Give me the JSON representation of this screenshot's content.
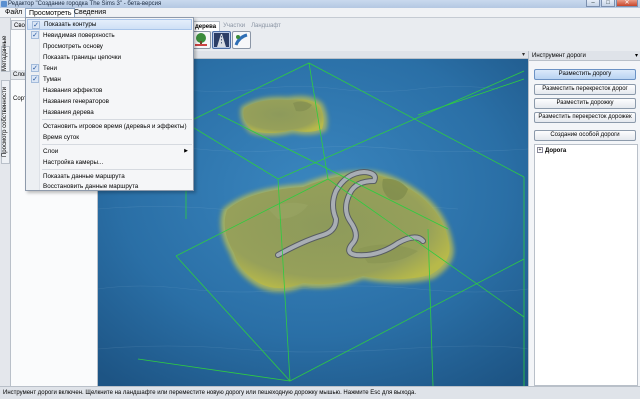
{
  "window": {
    "title": "Редактор \"Создание городка The Sims 3\" - бета-версия",
    "min": "–",
    "max": "□",
    "close": "✕"
  },
  "menubar": [
    {
      "label": "Файл"
    },
    {
      "label": "Просмотреть"
    },
    {
      "label": "Сведения"
    }
  ],
  "left_rail_tabs": [
    "Метаданные",
    "Просмотр собственности"
  ],
  "left_panel": {
    "tab_label": "Своб",
    "strip_label": "Слои",
    "row_label": "Сорт"
  },
  "top_tabs": [
    {
      "label": "дерева"
    },
    {
      "label": "Участки"
    },
    {
      "label": "Ландшафт"
    }
  ],
  "viewport": {
    "pin": "▾"
  },
  "view_menu": {
    "items": [
      {
        "label": "Показать контуры",
        "checked": true
      },
      {
        "label": "Невидимая поверхность",
        "checked": true
      },
      {
        "label": "Просмотреть основу",
        "checked": false
      },
      {
        "label": "Показать границы цепочки",
        "checked": false
      },
      {
        "label": "Тени",
        "checked": true
      },
      {
        "label": "Туман",
        "checked": true
      },
      {
        "label": "Названия эффектов",
        "checked": false
      },
      {
        "label": "Названия генераторов",
        "checked": false
      },
      {
        "label": "Названия дерева",
        "checked": false
      },
      {
        "label": "Остановить игровое время (деревья и эффекты)",
        "checked": false
      },
      {
        "label": "Время суток",
        "checked": false
      },
      {
        "label": "Слои",
        "checked": false,
        "submenu_arrow": "▶"
      },
      {
        "label": "Настройка камеры...",
        "checked": false
      },
      {
        "label": "Показать данные маршрута",
        "checked": false
      },
      {
        "label": "Восстановить данные маршрута",
        "checked": false
      }
    ],
    "check_glyph": "✓"
  },
  "right_panel": {
    "header": "Инструмент дороги",
    "pin": "▾",
    "buttons": [
      {
        "label": "Разместить дорогу"
      },
      {
        "label": "Разместить перекресток дорог"
      },
      {
        "label": "Разместить дорожку"
      },
      {
        "label": "Разместить перекресток дорожек"
      },
      {
        "label": "Создание особой дороги"
      }
    ],
    "tree": {
      "expander": "+",
      "label": "Дорога"
    }
  },
  "statusbar": {
    "text": "Инструмент дороги включен. Щелкните на ландшафте или переместите новую дорогу или пешеходную дорожку мышью. Нажмите Esc для выхода."
  },
  "colors": {
    "water": "#2a6fa6",
    "island": "#8f9c5a",
    "outline": "#2ecc40",
    "road": "#a9aeb4"
  }
}
